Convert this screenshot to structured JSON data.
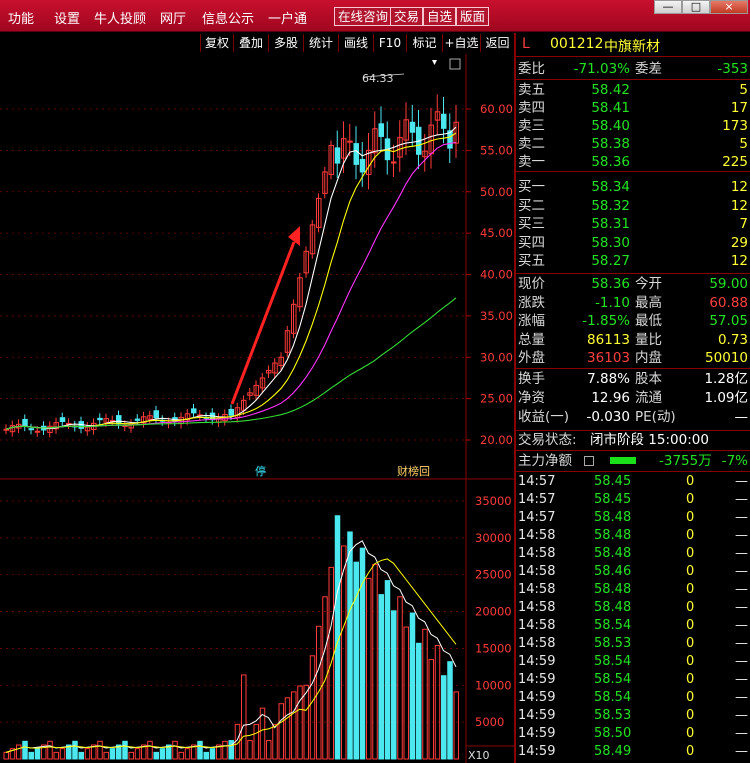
{
  "menu": {
    "items": [
      "功能",
      "设置",
      "牛人投顾",
      "网厅",
      "信息公示",
      "一户通"
    ],
    "buttons": [
      "在线咨询",
      "交易",
      "自选",
      "版面"
    ],
    "window_controls": [
      "—",
      "□",
      "×"
    ]
  },
  "toolbar": {
    "buttons": [
      "复权",
      "叠加",
      "多股",
      "统计",
      "画线",
      "F10",
      "标记",
      "+自选",
      "返回"
    ]
  },
  "chart": {
    "price_axis": [
      "60.00",
      "55.00",
      "50.00",
      "45.00",
      "40.00",
      "35.00",
      "30.00",
      "25.00",
      "20.00"
    ],
    "volume_axis": [
      "35000",
      "30000",
      "25000",
      "20000",
      "15000",
      "10000",
      "5000"
    ],
    "volume_unit": "X10",
    "high_label": "64.33",
    "marker_stop": "停",
    "marker_rank": "财榜回",
    "colors": {
      "up": "#ff3a3a",
      "down": "#4ce8f0",
      "ma5": "#ffffff",
      "ma10": "#ffff00",
      "ma20": "#ff33ff",
      "ma60": "#33dd33",
      "arrow": "#ff2222"
    }
  },
  "stock": {
    "prefix": "L",
    "code": "001212",
    "name": "中旗新材",
    "webi_label": "委比",
    "webi_value": "-71.03%",
    "weicha_label": "委差",
    "weicha_value": "-353",
    "asks": [
      {
        "label": "卖五",
        "price": "58.42",
        "vol": "5"
      },
      {
        "label": "卖四",
        "price": "58.41",
        "vol": "17"
      },
      {
        "label": "卖三",
        "price": "58.40",
        "vol": "173"
      },
      {
        "label": "卖二",
        "price": "58.38",
        "vol": "5"
      },
      {
        "label": "卖一",
        "price": "58.36",
        "vol": "225"
      }
    ],
    "bids": [
      {
        "label": "买一",
        "price": "58.34",
        "vol": "12"
      },
      {
        "label": "买二",
        "price": "58.32",
        "vol": "12"
      },
      {
        "label": "买三",
        "price": "58.31",
        "vol": "7"
      },
      {
        "label": "买四",
        "price": "58.30",
        "vol": "29"
      },
      {
        "label": "买五",
        "price": "58.27",
        "vol": "12"
      }
    ],
    "stats": [
      {
        "l1": "现价",
        "v1": "58.36",
        "c1": "green",
        "l2": "今开",
        "v2": "59.00",
        "c2": "green"
      },
      {
        "l1": "涨跌",
        "v1": "-1.10",
        "c1": "green",
        "l2": "最高",
        "v2": "60.88",
        "c2": "red"
      },
      {
        "l1": "涨幅",
        "v1": "-1.85%",
        "c1": "green",
        "l2": "最低",
        "v2": "57.05",
        "c2": "green"
      },
      {
        "l1": "总量",
        "v1": "86113",
        "c1": "yellow",
        "l2": "量比",
        "v2": "0.73",
        "c2": "yellow"
      },
      {
        "l1": "外盘",
        "v1": "36103",
        "c1": "red",
        "l2": "内盘",
        "v2": "50010",
        "c2": "yellow"
      }
    ],
    "stats2": [
      {
        "l1": "换手",
        "v1": "7.88%",
        "l2": "股本",
        "v2": "1.28亿"
      },
      {
        "l1": "净资",
        "v1": "12.96",
        "l2": "流通",
        "v2": "1.09亿"
      },
      {
        "l1": "收益(一)",
        "v1": "-0.030",
        "l2": "PE(动)",
        "v2": "—"
      }
    ],
    "trade_status_label": "交易状态:",
    "trade_status_value": "闭市阶段 15:00:00",
    "main_net_label": "主力净额",
    "main_net_value": "-3755万",
    "main_net_pct": "-7%"
  },
  "ticks": [
    {
      "time": "14:57",
      "price": "58.45",
      "vol": "0",
      "dir": "—"
    },
    {
      "time": "14:57",
      "price": "58.45",
      "vol": "0",
      "dir": "—"
    },
    {
      "time": "14:57",
      "price": "58.48",
      "vol": "0",
      "dir": "—"
    },
    {
      "time": "14:58",
      "price": "58.48",
      "vol": "0",
      "dir": "—"
    },
    {
      "time": "14:58",
      "price": "58.48",
      "vol": "0",
      "dir": "—"
    },
    {
      "time": "14:58",
      "price": "58.46",
      "vol": "0",
      "dir": "—"
    },
    {
      "time": "14:58",
      "price": "58.48",
      "vol": "0",
      "dir": "—"
    },
    {
      "time": "14:58",
      "price": "58.48",
      "vol": "0",
      "dir": "—"
    },
    {
      "time": "14:58",
      "price": "58.54",
      "vol": "0",
      "dir": "—"
    },
    {
      "time": "14:58",
      "price": "58.53",
      "vol": "0",
      "dir": "—"
    },
    {
      "time": "14:59",
      "price": "58.54",
      "vol": "0",
      "dir": "—"
    },
    {
      "time": "14:59",
      "price": "58.54",
      "vol": "0",
      "dir": "—"
    },
    {
      "time": "14:59",
      "price": "58.54",
      "vol": "0",
      "dir": "—"
    },
    {
      "time": "14:59",
      "price": "58.53",
      "vol": "0",
      "dir": "—"
    },
    {
      "time": "14:59",
      "price": "58.50",
      "vol": "0",
      "dir": "—"
    },
    {
      "time": "14:59",
      "price": "58.49",
      "vol": "0",
      "dir": "—"
    }
  ]
}
